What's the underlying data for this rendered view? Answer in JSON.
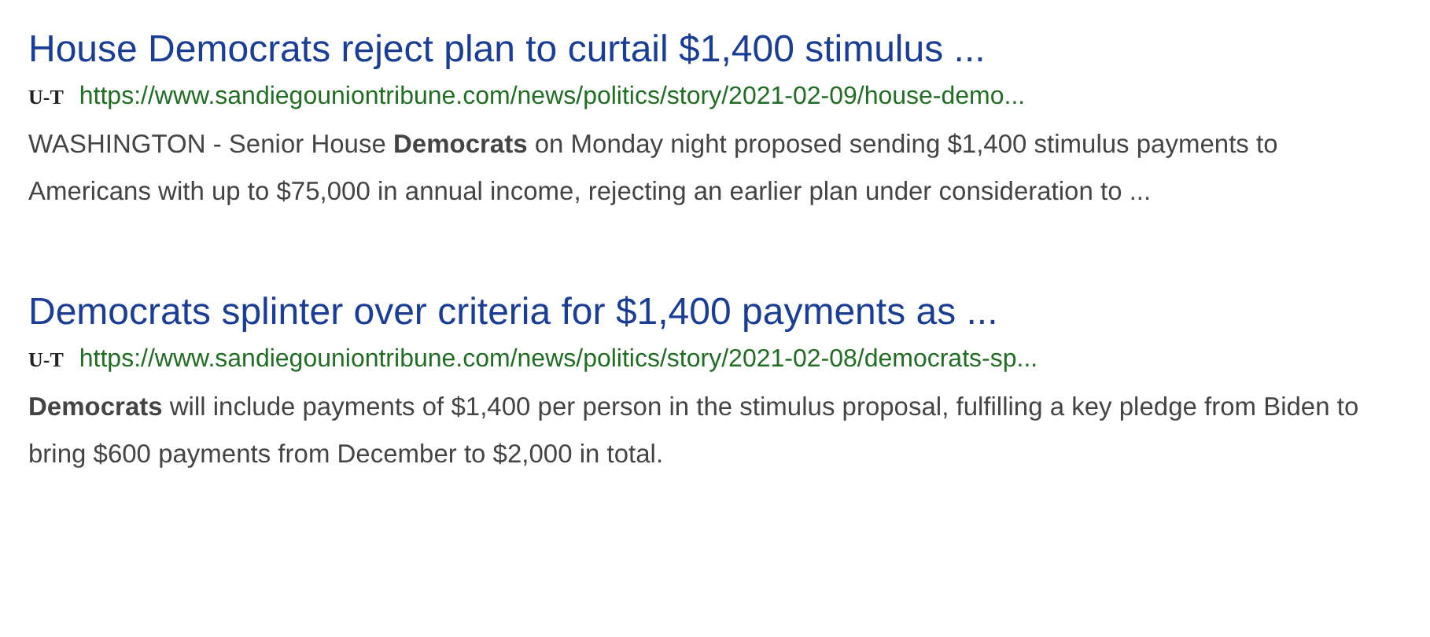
{
  "results": [
    {
      "title": "House Democrats reject plan to curtail $1,400 stimulus ...",
      "favicon": "U-T",
      "url": "https://www.sandiegouniontribune.com/news/politics/story/2021-02-09/house-demo...",
      "snippet": "WASHINGTON - Senior House **Democrats** on Monday night proposed sending $1,400 stimulus payments to Americans with up to $75,000 in annual income, rejecting an earlier plan under consideration to ..."
    },
    {
      "title": "Democrats splinter over criteria for $1,400 payments as ...",
      "favicon": "U-T",
      "url": "https://www.sandiegouniontribune.com/news/politics/story/2021-02-08/democrats-sp...",
      "snippet": "**Democrats** will include payments of $1,400 per person in the stimulus proposal, fulfilling a key pledge from Biden to bring $600 payments from December to $2,000 in total."
    }
  ]
}
